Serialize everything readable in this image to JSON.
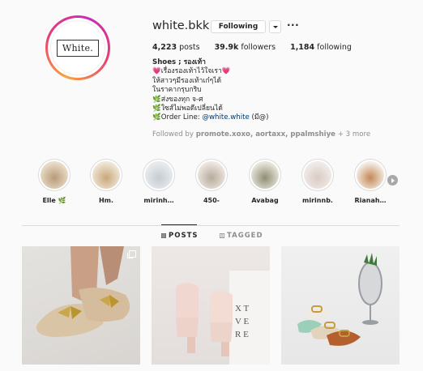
{
  "profile": {
    "logo_text": "White.",
    "username": "white.bkk",
    "follow_label": "Following",
    "more_label": "···",
    "stats": {
      "posts_value": "4,223",
      "posts_label": "posts",
      "followers_value": "39.9k",
      "followers_label": "followers",
      "following_value": "1,184",
      "following_label": "following"
    },
    "bio": {
      "title": "Shoes ; รองเท้า",
      "line1": "💗เรื่องรองเท้าไว้ใจเรา💗",
      "line2": "ให้สาวๆมีรองเท้าเก๋ๆได้",
      "line3": "ในราคากรุบกริบ",
      "line4": "🌿ส่งของทุก จ-ศ",
      "line5": "🌿ใซส์ไม่พอดีเปลี่ยนได้",
      "line6_prefix": "🌿Order Line: ",
      "line6_link": "@white.white",
      "line6_suffix": " (มี@)"
    },
    "followed_by_prefix": "Followed by ",
    "followed_by_names": "promote.xoxo, aortaxx, ppalmshiye",
    "followed_by_more": " + 3 more"
  },
  "highlights": [
    {
      "label": "Elle 🌿",
      "color_a": "#e9dcc8",
      "color_b": "#b89a78"
    },
    {
      "label": "Hm.",
      "color_a": "#efe6d6",
      "color_b": "#c9a77a"
    },
    {
      "label": "mirinh…",
      "color_a": "#e8ebee",
      "color_b": "#c6ccd2"
    },
    {
      "label": "450-",
      "color_a": "#ece6df",
      "color_b": "#b7ab9c"
    },
    {
      "label": "Avabag",
      "color_a": "#e7e4da",
      "color_b": "#8f8e72"
    },
    {
      "label": "mirinnb.",
      "color_a": "#f0ebe8",
      "color_b": "#d9cbc4"
    },
    {
      "label": "Rianah…",
      "color_a": "#f3ede5",
      "color_b": "#c48856"
    }
  ],
  "tabs": {
    "posts_label": "POSTS",
    "tagged_label": "TAGGED"
  },
  "colors": {
    "link": "#00376b",
    "muted": "#8e8e8e",
    "text": "#262626"
  }
}
